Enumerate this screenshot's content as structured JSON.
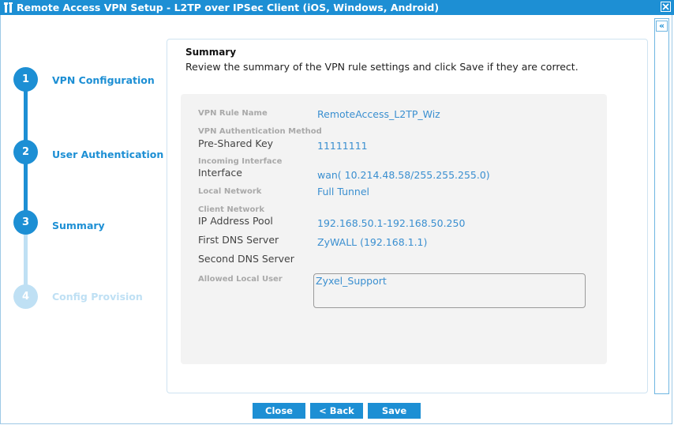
{
  "window": {
    "title": "Remote Access VPN Setup - L2TP over IPSec Client (iOS, Windows, Android)",
    "icon": "tools-icon",
    "close_icon": "close-icon",
    "collapse_label": "«"
  },
  "steps": [
    {
      "number": "1",
      "label": "VPN Configuration",
      "state": "done"
    },
    {
      "number": "2",
      "label": "User Authentication",
      "state": "done"
    },
    {
      "number": "3",
      "label": "Summary",
      "state": "current"
    },
    {
      "number": "4",
      "label": "Config Provision",
      "state": "pending"
    }
  ],
  "colors": {
    "accent": "#1d8fd4",
    "pending": "#bfe0f4",
    "value": "#3a8fd0",
    "label": "#a9a9a9"
  },
  "summary": {
    "title": "Summary",
    "description": "Review the summary of the VPN rule settings and click Save if they are correct.",
    "fields": {
      "vpn_rule_name": {
        "label": "VPN Rule Name",
        "value": "RemoteAccess_L2TP_Wiz"
      },
      "auth_method": {
        "group": "VPN Authentication Method",
        "label": "Pre-Shared Key",
        "value": "11111111"
      },
      "incoming_interface": {
        "group": "Incoming Interface",
        "label": "Interface",
        "value": "wan( 10.214.48.58/255.255.255.0)"
      },
      "local_network": {
        "label": "Local Network",
        "value": "Full Tunnel"
      },
      "client_network": {
        "group": "Client Network",
        "label": "IP Address Pool",
        "value": "192.168.50.1-192.168.50.250"
      },
      "first_dns": {
        "label": "First DNS Server",
        "value": "ZyWALL (192.168.1.1)"
      },
      "second_dns": {
        "label": "Second DNS Server",
        "value": ""
      },
      "allowed_local_user": {
        "label": "Allowed Local User",
        "value": "Zyxel_Support"
      }
    }
  },
  "buttons": {
    "close": "Close",
    "back": "< Back",
    "save": "Save"
  }
}
